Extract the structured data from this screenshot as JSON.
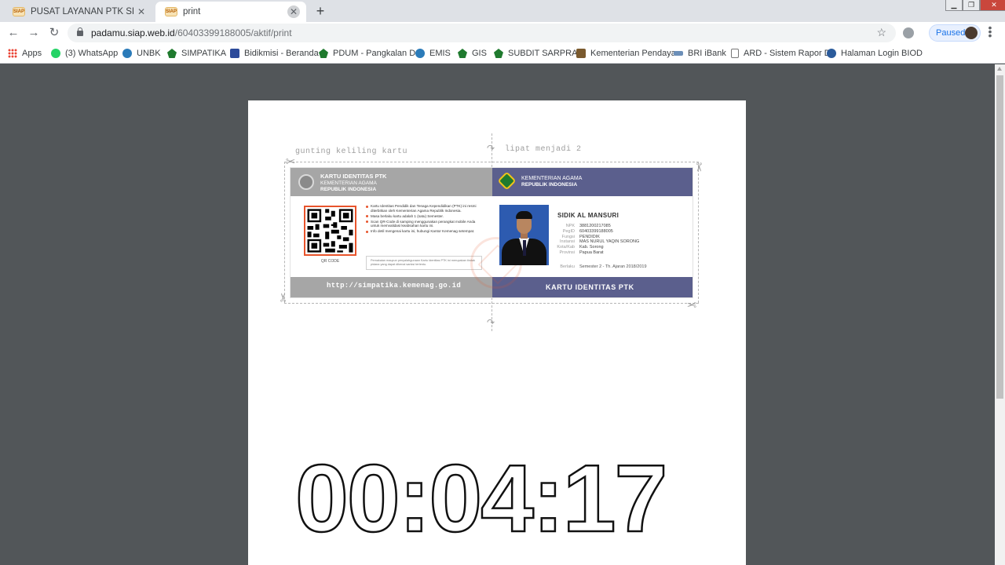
{
  "tabs": [
    {
      "favicon": "SIAP",
      "title": "PUSAT LAYANAN PTK SIMPATIKA",
      "active": false
    },
    {
      "favicon": "SIAP",
      "title": "print",
      "active": true
    }
  ],
  "omnibox": {
    "host": "padamu.siap.web.id",
    "path": "/60403399188005/aktif/print"
  },
  "profile": {
    "status": "Paused"
  },
  "bookmarks": [
    {
      "label": "Apps",
      "icon": "apps-grid-icon",
      "color": "#1a73e8"
    },
    {
      "label": "(3) WhatsApp",
      "icon": "whatsapp-icon",
      "color": "#25d366"
    },
    {
      "label": "UNBK",
      "icon": "globe-icon",
      "color": "#2b7bb9"
    },
    {
      "label": "SIMPATIKA",
      "icon": "kemenag-emblem-icon",
      "color": "#1f7a2e"
    },
    {
      "label": "Bidikmisi - Beranda",
      "icon": "bidikmisi-icon",
      "color": "#2c4a9a"
    },
    {
      "label": "PDUM - Pangkalan D",
      "icon": "kemenag-emblem-icon",
      "color": "#1f7a2e"
    },
    {
      "label": "EMIS",
      "icon": "emis-icon",
      "color": "#2b7bb9"
    },
    {
      "label": "GIS",
      "icon": "kemenag-emblem-icon",
      "color": "#1f7a2e"
    },
    {
      "label": "SUBDIT SARPRAS",
      "icon": "kemenag-emblem-icon",
      "color": "#1f7a2e"
    },
    {
      "label": "Kementerian Pendaya",
      "icon": "building-icon",
      "color": "#7a5a2e"
    },
    {
      "label": "BRI iBank",
      "icon": "bri-icon",
      "color": "#6c8fb8"
    },
    {
      "label": "ARD - Sistem Rapor D",
      "icon": "page-icon",
      "color": "#777777"
    },
    {
      "label": "Halaman Login BIOD",
      "icon": "globe-icon",
      "color": "#2b5b9b"
    }
  ],
  "print_page": {
    "cut_label": "gunting keliling kartu",
    "fold_label": "lipat menjadi 2"
  },
  "card": {
    "left_header": {
      "title": "KARTU IDENTITAS PTK",
      "sub1": "KEMENTERIAN AGAMA",
      "sub2": "REPUBLIK INDONESIA"
    },
    "right_header": {
      "sub1": "KEMENTERIAN AGAMA",
      "sub2": "REPUBLIK INDONESIA"
    },
    "qr_label": "QR CODE",
    "bullets": [
      "Kartu Identitas Pendidik dan Tenaga Kependidikan (PTK) ini resmi diterbitkan oleh Kementerian Agama Republik Indonesia.",
      "Masa berlaku kartu adalah 1 (satu) Semester.",
      "Scan QR-Code di samping menggunakan perangkat mobile Anda untuk memvalidasi keabsahan kartu ini.",
      "Info detil mengenai kartu ini, hubungi Kantor Kemenag setempat."
    ],
    "note": "Pemakaian maupun penyalahgunaan Kartu Identitas PTK ini merupakan tindak pidana yang dapat dikenai sanksi tertentu.",
    "name": "SIDIK AL MANSURI",
    "fields": [
      {
        "k": "NPK",
        "v": "3881200217085"
      },
      {
        "k": "PegID",
        "v": "60403399188005"
      },
      {
        "k": "Fungsi",
        "v": "PENDIDIK"
      },
      {
        "k": "Instansi",
        "v": "MAS NURUL YAQIN SORONG"
      },
      {
        "k": "Kota/Kab",
        "v": "Kab. Sorong"
      },
      {
        "k": "Provinsi",
        "v": "Papua Barat"
      }
    ],
    "berlaku": {
      "k": "Berlaku",
      "v": "Semester 2 - Th. Ajaran 2018/2019"
    },
    "footer_left": "http://simpatika.kemenag.go.id",
    "footer_right": "KARTU IDENTITAS PTK"
  },
  "timer": "00:04:17"
}
